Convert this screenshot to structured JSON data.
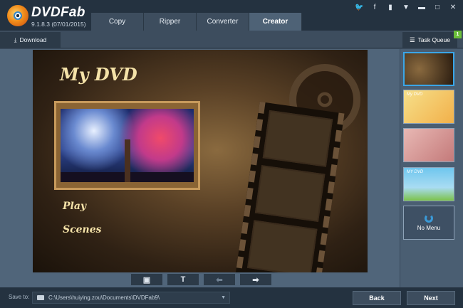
{
  "app": {
    "name": "DVDFab",
    "version": "9.1.8.3 (07/01/2015)"
  },
  "tabs": [
    {
      "label": "Copy",
      "active": false
    },
    {
      "label": "Ripper",
      "active": false
    },
    {
      "label": "Converter",
      "active": false
    },
    {
      "label": "Creator",
      "active": true
    }
  ],
  "window_controls": [
    "twitter-icon",
    "facebook-icon",
    "menu-icon",
    "dropdown-icon",
    "minimize-icon",
    "maximize-icon",
    "close-icon"
  ],
  "toolbar": {
    "download_label": "Download",
    "task_queue_label": "Task Queue",
    "task_queue_count": "1"
  },
  "preview": {
    "title": "My DVD",
    "menu_items": [
      "Play",
      "Scenes"
    ]
  },
  "preview_tools": [
    {
      "icon": "image-icon",
      "label": "",
      "enabled": true
    },
    {
      "icon": "text-icon",
      "label": "T",
      "enabled": true
    },
    {
      "icon": "arrow-left-icon",
      "label": "⬅",
      "enabled": false
    },
    {
      "icon": "arrow-right-icon",
      "label": "➡",
      "enabled": true
    }
  ],
  "templates": {
    "thumbnails": [
      {
        "label": "",
        "selected": true
      },
      {
        "label": "My DVD",
        "selected": false
      },
      {
        "label": "",
        "selected": false
      },
      {
        "label": "MY DVD",
        "selected": false
      }
    ],
    "no_menu_label": "No Menu"
  },
  "footer": {
    "save_to_label": "Save to:",
    "save_path": "C:\\Users\\huiying.zou\\Documents\\DVDFab9\\",
    "back_label": "Back",
    "next_label": "Next"
  },
  "colors": {
    "topbar": "#243240",
    "accent_selected": "#3aa6e8",
    "badge": "#6bbf3a"
  }
}
